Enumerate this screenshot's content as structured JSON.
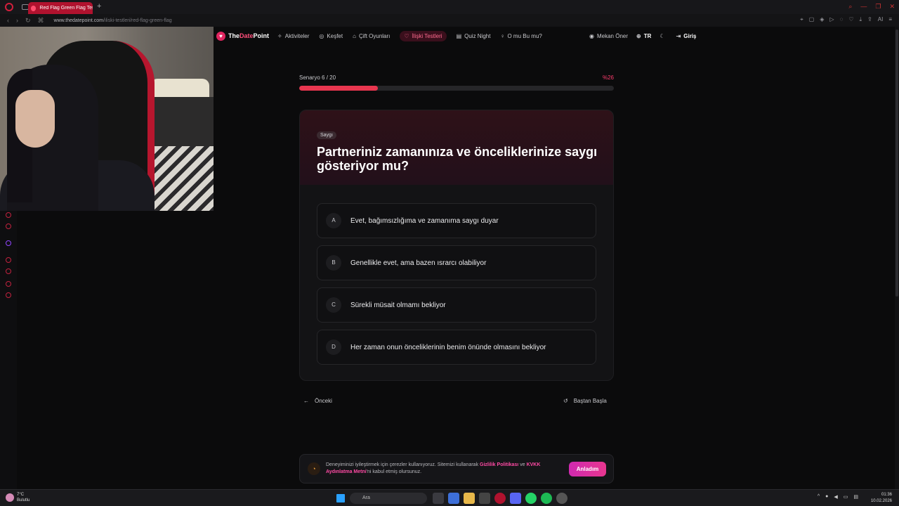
{
  "browser": {
    "tab_title": "Red Flag Green Flag Testi",
    "new_tab": "+",
    "url_host": "www.thedatepoint.com",
    "url_path": "/iliski-testleri/red-flag-green-flag",
    "ai_label": "AI"
  },
  "site": {
    "brand_the": "The",
    "brand_date": "Date",
    "brand_point": "Point",
    "nav": [
      {
        "label": "Aktiviteler",
        "icon": "✧"
      },
      {
        "label": "Keşfet",
        "icon": "◎"
      },
      {
        "label": "Çift Oyunları",
        "icon": "⌂"
      },
      {
        "label": "İlişki Testleri",
        "icon": "♡"
      },
      {
        "label": "Quiz Night",
        "icon": "▤"
      },
      {
        "label": "O mu Bu mu?",
        "icon": "♀"
      }
    ],
    "nav_right": {
      "suggest": "Mekan Öner",
      "lang": "TR",
      "login": "Giriş"
    }
  },
  "quiz": {
    "progress_label": "Senaryo 6 / 20",
    "progress_percent_text": "%26",
    "progress_value": 0.25,
    "category": "Saygı",
    "question": "Partneriniz zamanınıza ve önceliklerinize saygı gösteriyor mu?",
    "options": [
      {
        "letter": "A",
        "text": "Evet, bağımsızlığıma ve zamanıma saygı duyar"
      },
      {
        "letter": "B",
        "text": "Genellikle evet, ama bazen ısrarcı olabiliyor"
      },
      {
        "letter": "C",
        "text": "Sürekli müsait olmamı bekliyor"
      },
      {
        "letter": "D",
        "text": "Her zaman onun önceliklerinin benim önünde olmasını bekliyor"
      }
    ],
    "prev_label": "Önceki",
    "restart_label": "Baştan Başla"
  },
  "cookie": {
    "text_1": "Deneyiminizi iyileştirmek için çerezler kullanıyoruz. Sitemizi kullanarak ",
    "link_1": "Gizlilik Politikası",
    "text_2": " ve ",
    "link_2": "KVKK Aydınlatma Metni",
    "text_3": "'ni kabul etmiş olursunuz.",
    "button": "Anladım"
  },
  "taskbar": {
    "temp": "7°C",
    "weather": "Bulutlu",
    "search": "Ara",
    "time": "01:36",
    "date": "10.02.2026"
  },
  "colors": {
    "accent": "#e8364f",
    "brand_pink": "#ff4f7b",
    "cookie_button": "#d02ab0"
  }
}
